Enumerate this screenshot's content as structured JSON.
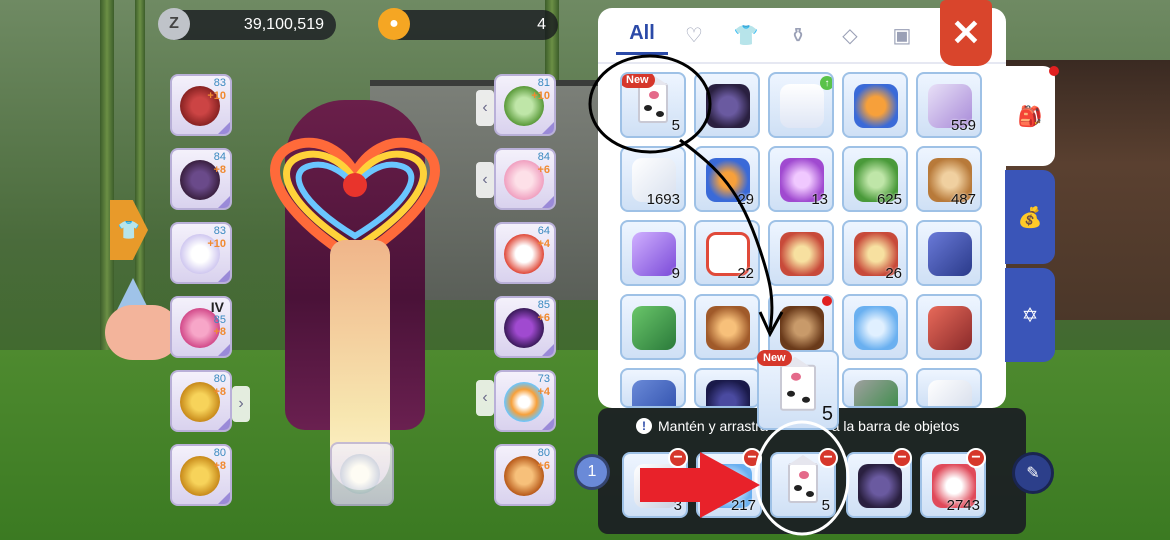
{
  "currency": {
    "zeny_icon": "zeny-coin-icon",
    "zeny": "39,100,519",
    "second_icon": "cat-coin-icon",
    "second": "4"
  },
  "equipment_left": [
    {
      "icon": "red-garment-icon",
      "level": "83",
      "refine": "+10"
    },
    {
      "icon": "dark-armor-icon",
      "level": "84",
      "refine": "+8"
    },
    {
      "icon": "white-robe-icon",
      "level": "83",
      "refine": "+10"
    },
    {
      "icon": "pink-shoes-icon",
      "tier": "IV",
      "level": "85",
      "refine": "+8"
    },
    {
      "icon": "gold-ring-icon",
      "level": "80",
      "refine": "+8"
    },
    {
      "icon": "gold-ring-icon",
      "level": "80",
      "refine": "+8"
    }
  ],
  "equipment_right": [
    {
      "icon": "green-weapon-icon",
      "level": "81",
      "refine": "+10"
    },
    {
      "icon": "pink-bow-icon",
      "level": "84",
      "refine": "+6"
    },
    {
      "icon": "egg-icon",
      "level": "64",
      "refine": "+4"
    },
    {
      "icon": "mask-icon",
      "level": "85",
      "refine": "+6"
    },
    {
      "icon": "rainbow-heart-icon",
      "level": "73",
      "refine": "+4"
    },
    {
      "icon": "rooster-icon",
      "level": "80",
      "refine": "+6"
    }
  ],
  "inventory": {
    "tabs": [
      "All",
      "heart-icon",
      "shirt-icon",
      "potion-icon",
      "diamond-icon",
      "card-icon"
    ],
    "active_tab": "All",
    "close_icon": "close-icon",
    "new_label": "New",
    "items": [
      {
        "icon": "milk-carton-icon",
        "qty": "5",
        "new": true
      },
      {
        "icon": "dragon-icon",
        "qty": ""
      },
      {
        "icon": "white-shirt-icon",
        "qty": ""
      },
      {
        "icon": "orange-creature-icon",
        "qty": ""
      },
      {
        "icon": "wing-feather-icon",
        "qty": "559"
      },
      {
        "icon": "white-feather-icon",
        "qty": "1693"
      },
      {
        "icon": "blue-orb-icon",
        "qty": "29"
      },
      {
        "icon": "purple-butterfly-icon",
        "qty": "13"
      },
      {
        "icon": "green-leaf-icon",
        "qty": "625"
      },
      {
        "icon": "treasure-box-icon",
        "qty": "487"
      },
      {
        "icon": "purple-card-icon",
        "qty": "9"
      },
      {
        "icon": "medkit-icon",
        "qty": "22"
      },
      {
        "icon": "bento-icon",
        "qty": ""
      },
      {
        "icon": "bento-icon",
        "qty": "26"
      },
      {
        "icon": "card-pack-icon",
        "qty": ""
      },
      {
        "icon": "green-book-icon",
        "qty": ""
      },
      {
        "icon": "pouch-icon",
        "qty": ""
      },
      {
        "icon": "brown-bag-icon",
        "qty": ""
      },
      {
        "icon": "blue-crystal-icon",
        "qty": ""
      },
      {
        "icon": "red-book-icon",
        "qty": ""
      },
      {
        "icon": "blue-scroll-icon",
        "qty": ""
      },
      {
        "icon": "dark-disc-icon",
        "qty": ""
      },
      {
        "icon": "unknown-item-icon",
        "qty": ""
      },
      {
        "icon": "green-machine-icon",
        "qty": ""
      },
      {
        "icon": "white-box-icon",
        "qty": ""
      }
    ],
    "side_tabs": [
      "backpack-icon",
      "zeny-bag-icon",
      "magic-circle-icon"
    ]
  },
  "drag_item": {
    "icon": "milk-carton-icon",
    "qty": "5",
    "new_label": "New"
  },
  "quickbar": {
    "hint": "Mantén y arrastra",
    "hint_end": "a la barra de objetos",
    "page": "1",
    "slots": [
      {
        "icon": "feather-quill-icon",
        "qty": "3"
      },
      {
        "icon": "blue-potion-icon",
        "qty": "217"
      },
      {
        "icon": "milk-carton-icon",
        "qty": "5"
      },
      {
        "icon": "dragon-icon",
        "qty": ""
      },
      {
        "icon": "candy-icon",
        "qty": "2743"
      }
    ],
    "edit_icon": "edit-icon"
  },
  "colors": {
    "accent": "#2b4aa8",
    "close": "#d9452c",
    "new": "#d6372b"
  }
}
